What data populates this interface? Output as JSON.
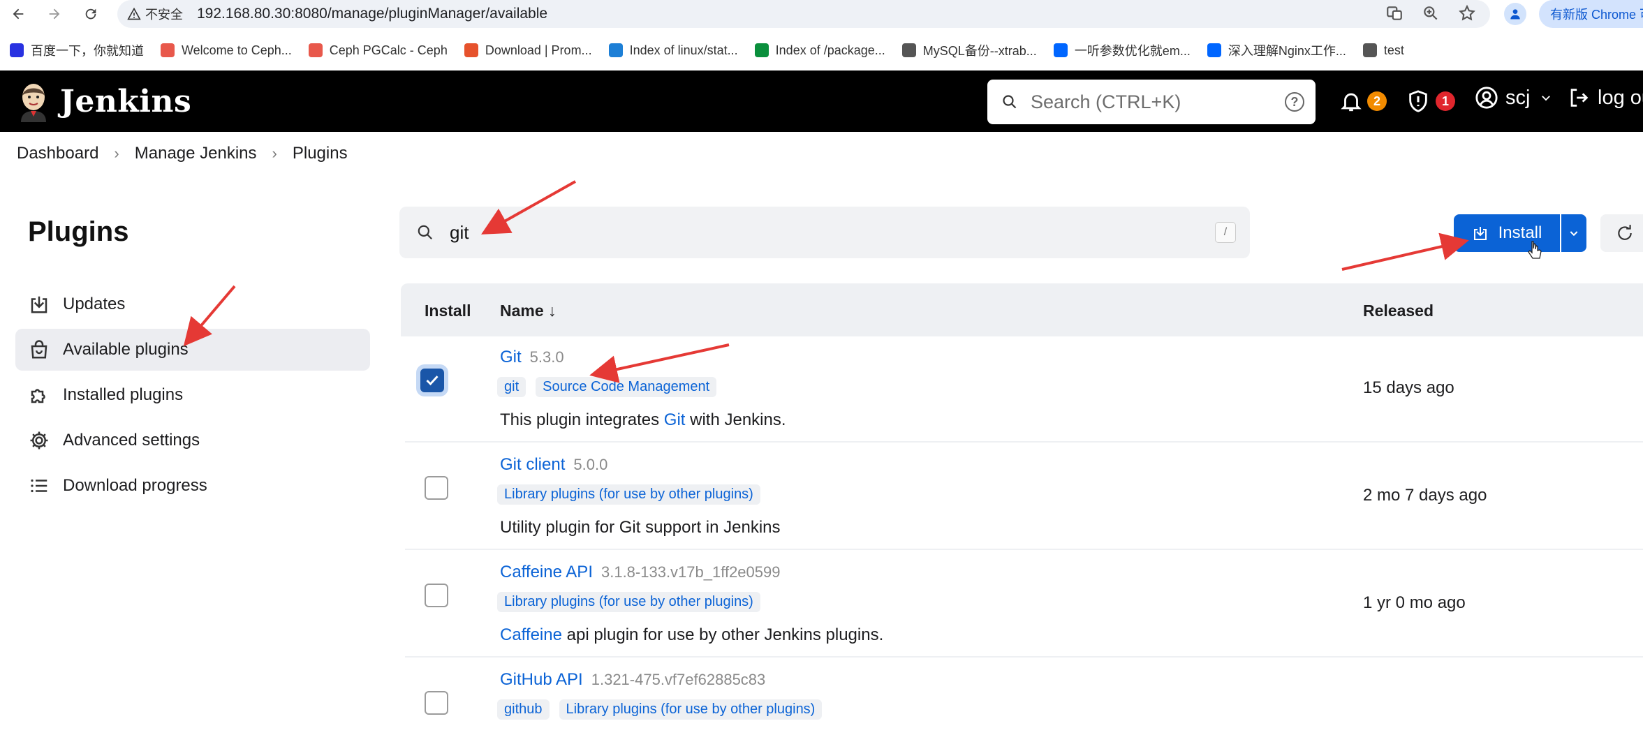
{
  "browser": {
    "insecure_label": "不安全",
    "url": "192.168.80.30:8080/manage/pluginManager/available",
    "update_label": "有新版 Chrome 可",
    "bookmarks": [
      {
        "label": "百度一下，你就知道",
        "color": "#2932e1"
      },
      {
        "label": "Welcome to Ceph...",
        "color": "#e8584b"
      },
      {
        "label": "Ceph PGCalc - Ceph",
        "color": "#e8584b"
      },
      {
        "label": "Download | Prom...",
        "color": "#e6522c"
      },
      {
        "label": "Index of linux/stat...",
        "color": "#1d7fd6"
      },
      {
        "label": "Index of /package...",
        "color": "#0a8f3c"
      },
      {
        "label": "MySQL备份--xtrab...",
        "color": "#555555"
      },
      {
        "label": "一听参数优化就em...",
        "color": "#0066ff"
      },
      {
        "label": "深入理解Nginx工作...",
        "color": "#0066ff"
      },
      {
        "label": "test",
        "color": "#555555"
      }
    ]
  },
  "header": {
    "app_name": "Jenkins",
    "search_placeholder": "Search (CTRL+K)",
    "notifications_count": "2",
    "security_count": "1",
    "username": "scj",
    "logout_label": "log out"
  },
  "breadcrumb": [
    "Dashboard",
    "Manage Jenkins",
    "Plugins"
  ],
  "sidebar": {
    "title": "Plugins",
    "items": [
      {
        "label": "Updates",
        "icon": "download-icon",
        "active": false
      },
      {
        "label": "Available plugins",
        "icon": "shopping-bag-icon",
        "active": true
      },
      {
        "label": "Installed plugins",
        "icon": "puzzle-icon",
        "active": false
      },
      {
        "label": "Advanced settings",
        "icon": "gear-icon",
        "active": false
      },
      {
        "label": "Download progress",
        "icon": "list-icon",
        "active": false
      }
    ]
  },
  "filter": {
    "value": "git",
    "shortcut": "/"
  },
  "actions": {
    "install_label": "Install"
  },
  "table": {
    "headers": {
      "install": "Install",
      "name": "Name ↓",
      "released": "Released"
    },
    "rows": [
      {
        "checked": true,
        "name": "Git",
        "version": "5.3.0",
        "tags": [
          "git",
          "Source Code Management"
        ],
        "desc_pre": "This plugin integrates ",
        "desc_link": "Git",
        "desc_post": " with Jenkins.",
        "released": "15 days ago"
      },
      {
        "checked": false,
        "name": "Git client",
        "version": "5.0.0",
        "tags": [
          "Library plugins (for use by other plugins)"
        ],
        "desc_pre": "Utility plugin for Git support in Jenkins",
        "desc_link": "",
        "desc_post": "",
        "released": "2 mo 7 days ago"
      },
      {
        "checked": false,
        "name": "Caffeine API",
        "version": "3.1.8-133.v17b_1ff2e0599",
        "tags": [
          "Library plugins (for use by other plugins)"
        ],
        "desc_pre": "",
        "desc_link": "Caffeine",
        "desc_post": " api plugin for use by other Jenkins plugins.",
        "released": "1 yr 0 mo ago"
      },
      {
        "checked": false,
        "name": "GitHub API",
        "version": "1.321-475.vf7ef62885c83",
        "tags": [
          "github",
          "Library plugins (for use by other plugins)"
        ],
        "desc_pre": "",
        "desc_link": "",
        "desc_post": "",
        "released": ""
      }
    ]
  },
  "colors": {
    "accent": "#0b63d6",
    "header_bg": "#000000",
    "annotation": "#e53935"
  }
}
